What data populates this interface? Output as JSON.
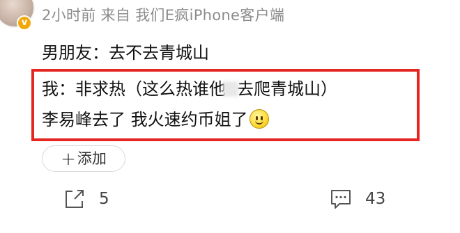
{
  "post": {
    "meta": "2小时前 来自 我们E疯iPhone客户端",
    "avatar_badge": "v",
    "lines": {
      "line1": "男朋友：去不去青城山",
      "line2_prefix": "我：非求热（这么热谁他",
      "line2_suffix": "去爬青城山）",
      "line3": "李易峰去了 我火速约币姐了"
    }
  },
  "actions": {
    "add_label": "添加",
    "add_plus": "+",
    "share_count": "5",
    "comment_count": "43"
  },
  "icons": {
    "avatar_badge": "vip-badge-icon",
    "emoji": "smiley-emoji-icon",
    "share": "share-icon",
    "comment": "comment-icon"
  },
  "colors": {
    "highlight_border": "#e52520",
    "meta_text": "#8c8c8c",
    "vip_badge": "#f2a80a"
  }
}
